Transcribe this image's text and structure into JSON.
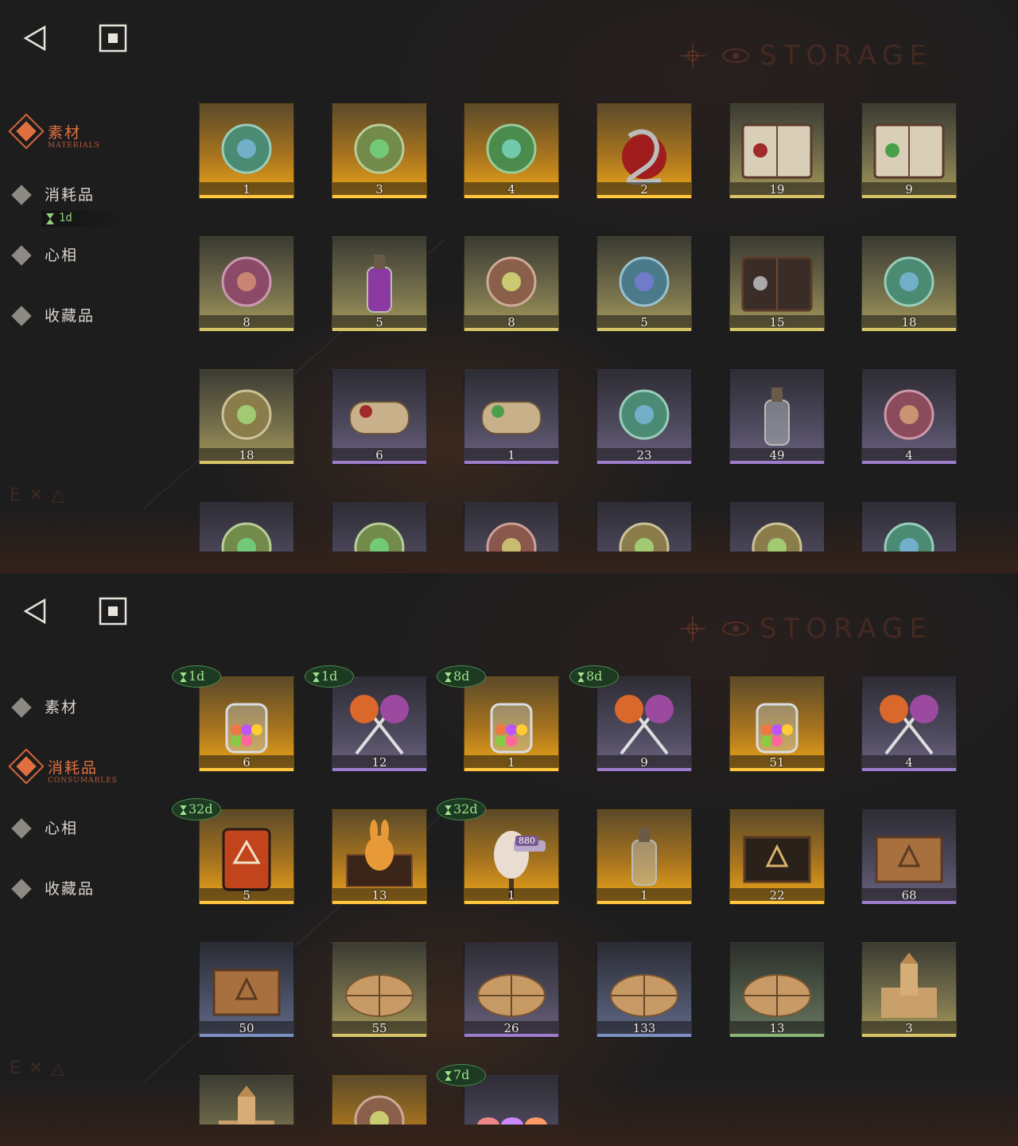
{
  "nav": {
    "back_icon": "back-triangle-icon",
    "recent_icon": "recent-apps-square-icon"
  },
  "watermark": {
    "title": "STORAGE"
  },
  "colors": {
    "accent": "#e07040",
    "timer_green": "#9ee28a",
    "gold": "#ffc640",
    "purple": "#9d7ccc",
    "blue": "#7e8fc4",
    "green": "#8ab478"
  },
  "screen1": {
    "categories": [
      {
        "label": "素材",
        "en": "MATERIALS",
        "active": true
      },
      {
        "label": "消耗品",
        "active": false
      },
      {
        "label": "心相",
        "active": false
      },
      {
        "label": "收藏品",
        "active": false
      }
    ],
    "consumables_timer": "1d",
    "items": [
      {
        "name": "caduceus-staff",
        "qty": "1",
        "rarity": "gold"
      },
      {
        "name": "fleece-sheep",
        "qty": "3",
        "rarity": "gold"
      },
      {
        "name": "laurel-wreath",
        "qty": "4",
        "rarity": "gold"
      },
      {
        "name": "apple-and-serpent",
        "qty": "2",
        "rarity": "gold"
      },
      {
        "name": "red-seal-book",
        "qty": "19",
        "rarity": "khaki"
      },
      {
        "name": "green-seal-book",
        "qty": "9",
        "rarity": "khaki"
      },
      {
        "name": "astrolabe",
        "qty": "8",
        "rarity": "khaki"
      },
      {
        "name": "purple-potion-bottle",
        "qty": "5",
        "rarity": "khaki"
      },
      {
        "name": "brass-compass-device",
        "qty": "8",
        "rarity": "khaki"
      },
      {
        "name": "glowing-firefly",
        "qty": "5",
        "rarity": "khaki"
      },
      {
        "name": "studded-tome",
        "qty": "15",
        "rarity": "khaki"
      },
      {
        "name": "silver-bullets",
        "qty": "18",
        "rarity": "khaki"
      },
      {
        "name": "hand-in-box",
        "qty": "18",
        "rarity": "khaki"
      },
      {
        "name": "red-seal-scroll",
        "qty": "6",
        "rarity": "purple"
      },
      {
        "name": "green-seal-scroll",
        "qty": "1",
        "rarity": "purple"
      },
      {
        "name": "scarab-pendant",
        "qty": "23",
        "rarity": "purple"
      },
      {
        "name": "crystal-horn",
        "qty": "49",
        "rarity": "purple"
      },
      {
        "name": "carved-stone-tablet",
        "qty": "4",
        "rarity": "purple"
      },
      {
        "name": "gothic-frame",
        "qty": "",
        "rarity": "purple"
      },
      {
        "name": "brass-device",
        "qty": "",
        "rarity": "purple"
      },
      {
        "name": "winged-key",
        "qty": "",
        "rarity": "purple"
      },
      {
        "name": "bronze-bird",
        "qty": "",
        "rarity": "purple"
      },
      {
        "name": "silver-bars",
        "qty": "",
        "rarity": "purple"
      },
      {
        "name": "skeleton-model",
        "qty": "",
        "rarity": "purple"
      }
    ]
  },
  "screen2": {
    "categories": [
      {
        "label": "素材",
        "active": false
      },
      {
        "label": "消耗品",
        "en": "CONSUMABLES",
        "active": true
      },
      {
        "label": "心相",
        "active": false
      },
      {
        "label": "收藏品",
        "active": false
      }
    ],
    "items": [
      {
        "name": "candy-jar",
        "qty": "6",
        "rarity": "gold",
        "timer": "1d"
      },
      {
        "name": "crossed-lollipops",
        "qty": "12",
        "rarity": "purple",
        "timer": "1d"
      },
      {
        "name": "candy-jar",
        "qty": "1",
        "rarity": "gold",
        "timer": "8d"
      },
      {
        "name": "crossed-lollipops",
        "qty": "9",
        "rarity": "purple",
        "timer": "8d"
      },
      {
        "name": "candy-jar",
        "qty": "51",
        "rarity": "gold",
        "timer": ""
      },
      {
        "name": "crossed-lollipops",
        "qty": "4",
        "rarity": "purple",
        "timer": ""
      },
      {
        "name": "rune-card-pack",
        "qty": "5",
        "rarity": "gold",
        "timer": "32d"
      },
      {
        "name": "golden-rabbit-box",
        "qty": "13",
        "rarity": "gold",
        "timer": ""
      },
      {
        "name": "tailor-mannequin",
        "qty": "1",
        "rarity": "gold",
        "timer": "32d",
        "price_tag": "880"
      },
      {
        "name": "message-bottle",
        "qty": "1",
        "rarity": "gold",
        "timer": ""
      },
      {
        "name": "rune-chest",
        "qty": "22",
        "rarity": "gold",
        "timer": ""
      },
      {
        "name": "wooden-crate",
        "qty": "68",
        "rarity": "purple",
        "timer": ""
      },
      {
        "name": "wooden-crate",
        "qty": "50",
        "rarity": "blue",
        "timer": ""
      },
      {
        "name": "paper-parcel",
        "qty": "55",
        "rarity": "khaki",
        "timer": ""
      },
      {
        "name": "paper-parcel",
        "qty": "26",
        "rarity": "purple",
        "timer": ""
      },
      {
        "name": "paper-parcel",
        "qty": "133",
        "rarity": "blue",
        "timer": ""
      },
      {
        "name": "paper-parcel",
        "qty": "13",
        "rarity": "green",
        "timer": ""
      },
      {
        "name": "sand-castle",
        "qty": "3",
        "rarity": "khaki",
        "timer": ""
      },
      {
        "name": "sand-castle",
        "qty": "",
        "rarity": "khaki",
        "timer": ""
      },
      {
        "name": "stained-glass-shield",
        "qty": "",
        "rarity": "gold",
        "timer": ""
      },
      {
        "name": "wrapped-candies",
        "qty": "",
        "rarity": "purple",
        "timer": "7d"
      }
    ]
  }
}
